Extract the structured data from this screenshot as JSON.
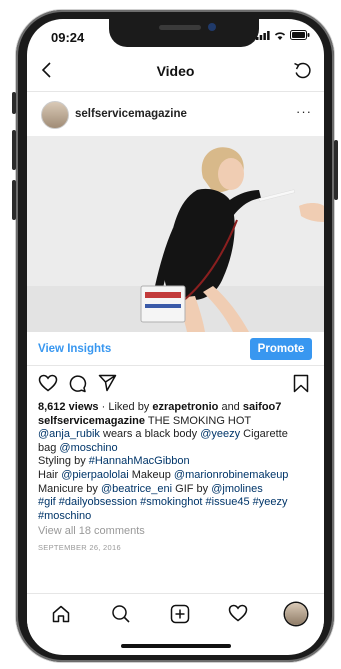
{
  "status": {
    "time": "09:24"
  },
  "nav": {
    "title": "Video"
  },
  "post": {
    "username": "selfservicemagazine",
    "more": "···"
  },
  "insights": {
    "view_label": "View Insights",
    "promote_label": "Promote"
  },
  "caption": {
    "views": "8,612 views",
    "liked_by_prefix": " · Liked by ",
    "liker1": "ezrapetronio",
    "and": " and ",
    "liker2": "saifoo7",
    "author": "selfservicemagazine",
    "line1_text": " THE SMOKING HOT",
    "mention_anja": "@anja_rubik",
    "text_wears": " wears a black body ",
    "mention_yeezy": "@yeezy",
    "text_cig": " Cigarette",
    "text_bag": "bag ",
    "mention_moschino": "@moschino",
    "text_styling": "Styling by ",
    "mention_hannah": "#HannahMacGibbon",
    "text_hair": "Hair ",
    "mention_pier": "@pierpaololai",
    "text_makeup": " Makeup ",
    "mention_marion": "@marionrobinemakeup",
    "text_manicure": "Manicure by ",
    "mention_beatrice": "@beatrice_eni",
    "text_gif": " GIF by ",
    "mention_jm": "@jmolines",
    "tags_line1": "#gif #dailyobsession #smokinghot #issue45 #yeezy",
    "tags_line2": "#moschino",
    "view_comments": "View all 18 comments",
    "date": "SEPTEMBER 26, 2016"
  },
  "tabs": [
    "home-icon",
    "search-icon",
    "add-post-icon",
    "activity-heart-icon",
    "profile-avatar"
  ],
  "colors": {
    "accent": "#3897f0",
    "link": "#003569",
    "muted": "#999999"
  }
}
